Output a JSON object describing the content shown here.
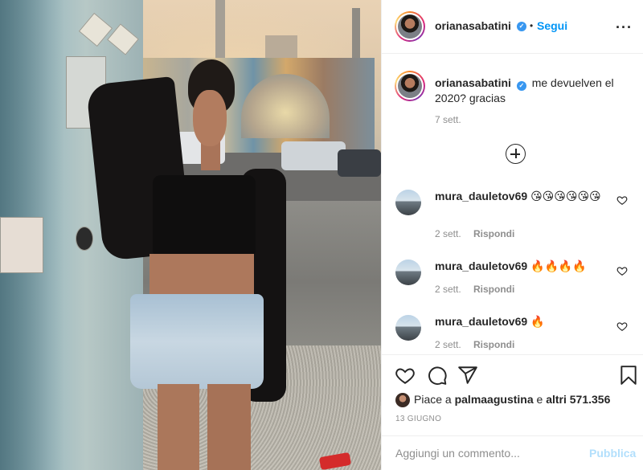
{
  "post": {
    "username": "orianasabatini",
    "follow_label": "Segui",
    "separator": "•",
    "more_label": "···"
  },
  "caption": {
    "username": "orianasabatini",
    "text": "me devuelven el 2020? gracias",
    "time": "7 sett."
  },
  "comments": [
    {
      "username": "mura_dauletov69",
      "text": "😘😘😘😘😘😘",
      "time": "2 sett.",
      "reply_label": "Rispondi"
    },
    {
      "username": "mura_dauletov69",
      "text": "🔥🔥🔥🔥",
      "time": "2 sett.",
      "reply_label": "Rispondi"
    },
    {
      "username": "mura_dauletov69",
      "text": "🔥",
      "time": "2 sett.",
      "reply_label": "Rispondi"
    }
  ],
  "likes": {
    "prefix": "Piace a ",
    "user": "palmaagustina",
    "middle": " e ",
    "count": "altri 571.356"
  },
  "date": "13 GIUGNO",
  "composer": {
    "placeholder": "Aggiungi un commento...",
    "publish_label": "Pubblica"
  },
  "colors": {
    "accent": "#0095f6",
    "verified": "#3897f0",
    "publish_disabled": "#b2dffc",
    "muted": "#8e8e8e"
  },
  "icons": [
    "more-icon",
    "verified-icon",
    "add-comments-icon",
    "heart-icon",
    "comment-icon",
    "share-icon",
    "bookmark-icon"
  ]
}
